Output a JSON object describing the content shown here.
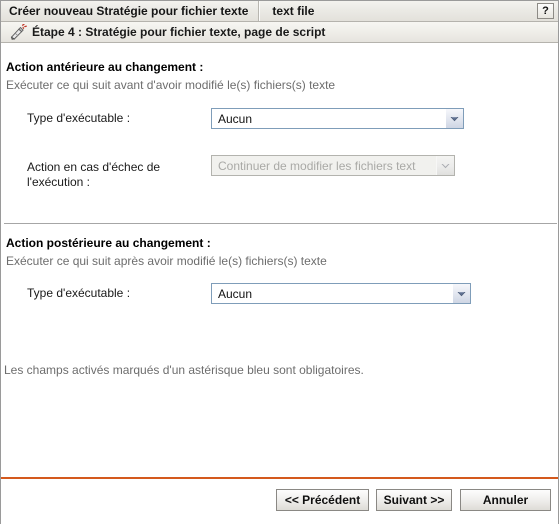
{
  "titlebar": {
    "title": "Créer nouveau Stratégie pour fichier texte",
    "subtitle": "text file",
    "help_label": "?"
  },
  "stepbar": {
    "icon": "script-pencil-icon",
    "label": "Étape 4 : Stratégie pour fichier texte, page de script"
  },
  "sections": [
    {
      "title": "Action antérieure au changement :",
      "description": "Exécuter ce qui suit avant d'avoir modifié le(s) fichiers(s) texte",
      "fields": [
        {
          "label": "Type d'exécutable :",
          "value": "Aucun",
          "disabled": false
        },
        {
          "label_line1": "Action en cas d'échec de",
          "label_line2": "l'exécution :",
          "value": "Continuer de modifier les fichiers text",
          "disabled": true
        }
      ]
    },
    {
      "title": "Action postérieure au changement :",
      "description": "Exécuter ce qui suit après avoir modifié le(s) fichiers(s) texte",
      "fields": [
        {
          "label": "Type d'exécutable :",
          "value": "Aucun",
          "disabled": false
        }
      ]
    }
  ],
  "note": "Les champs activés marqués d'un astérisque bleu sont obligatoires.",
  "footer": {
    "back_label": "<< Précédent",
    "next_label": "Suivant >>",
    "cancel_label": "Annuler",
    "rule_color": "#d4591d"
  },
  "colors": {
    "combo_border": "#7f9db9",
    "disabled_text": "#a9a9a6",
    "muted_text": "#6d6d6d",
    "accent": "#d4591d"
  }
}
